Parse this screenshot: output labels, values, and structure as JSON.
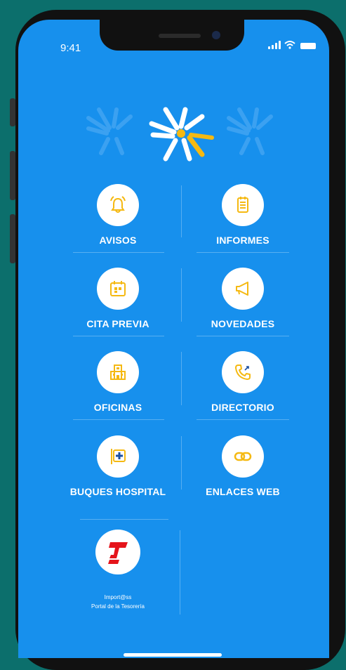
{
  "status_bar": {
    "time": "9:41"
  },
  "menu": {
    "avisos": "AVISOS",
    "informes": "INFORMES",
    "cita_previa": "CITA PREVIA",
    "novedades": "NOVEDADES",
    "oficinas": "OFICINAS",
    "directorio": "DIRECTORIO",
    "buques_hospital": "BUQUES HOSPITAL",
    "enlaces_web": "ENLACES WEB"
  },
  "importass": {
    "title": "Import@ss",
    "subtitle": "Portal de la Tesorería"
  },
  "colors": {
    "background": "#1790ed",
    "icon": "#f5b912",
    "frame": "#0c6f6c",
    "importass_red": "#e5141b"
  }
}
